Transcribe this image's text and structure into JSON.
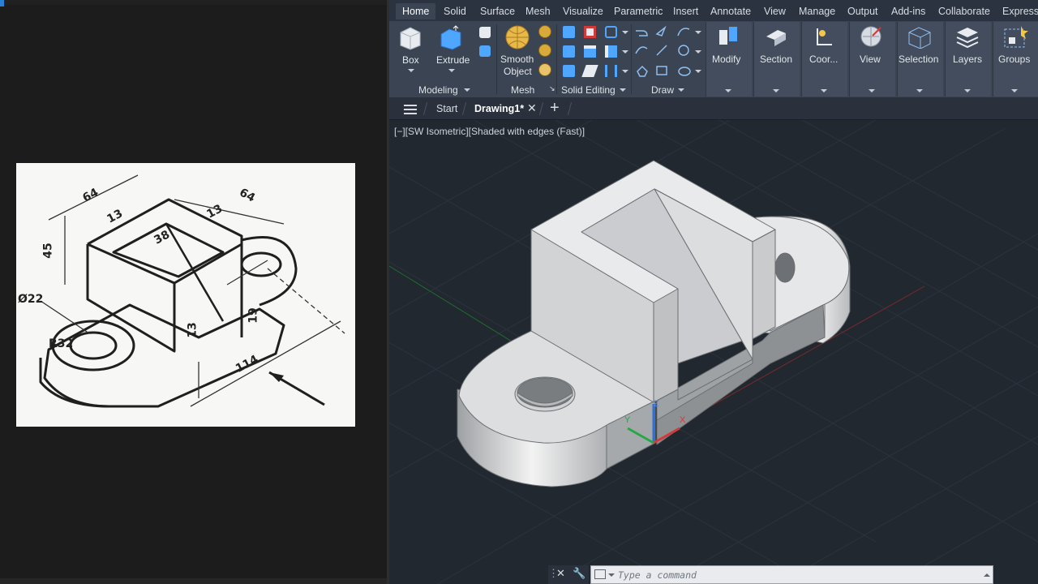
{
  "left_pane": {
    "sketch": {
      "dimensions": [
        "64",
        "64",
        "13",
        "13",
        "38",
        "45",
        "Ø22",
        "R32",
        "13",
        "19",
        "114"
      ]
    }
  },
  "ribbon": {
    "tabs": [
      "Home",
      "Solid",
      "Surface",
      "Mesh",
      "Visualize",
      "Parametric",
      "Insert",
      "Annotate",
      "View",
      "Manage",
      "Output",
      "Add-ins",
      "Collaborate",
      "Express T"
    ],
    "active_tab": "Home",
    "buttons": {
      "box": "Box",
      "extrude": "Extrude",
      "smooth_object_line1": "Smooth",
      "smooth_object_line2": "Object",
      "modify": "Modify",
      "section": "Section",
      "coordinates": "Coor...",
      "view": "View",
      "selection": "Selection",
      "layers": "Layers",
      "groups": "Groups"
    },
    "groups": {
      "modeling": "Modeling",
      "mesh": "Mesh",
      "solid_editing": "Solid Editing",
      "draw": "Draw"
    }
  },
  "file_tabs": {
    "start": "Start",
    "drawing": "Drawing1*"
  },
  "viewport": {
    "label": "[−][SW Isometric][Shaded with edges (Fast)]",
    "ucs_z": "Z",
    "ucs_x": "X",
    "ucs_y": "Y"
  },
  "command_line": {
    "placeholder": "Type a command"
  },
  "colors": {
    "ribbon_bg": "#3b4453",
    "viewport_bg": "#212830",
    "x_axis": "#d23a3a",
    "y_axis": "#28a745",
    "z_axis": "#2f6fd6"
  }
}
